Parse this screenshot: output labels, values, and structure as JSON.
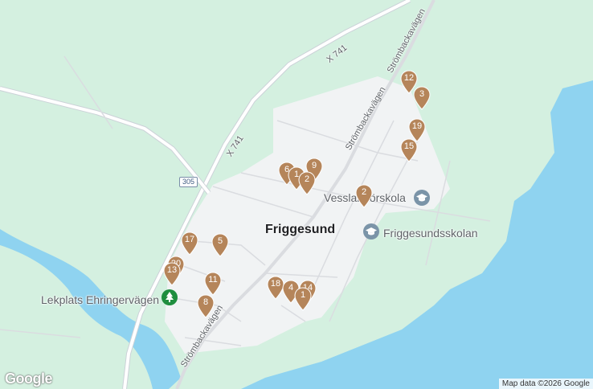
{
  "map": {
    "town_label": "Friggesund",
    "pois": [
      {
        "id": "vesslan",
        "label": "Vesslan förskola",
        "icon": "school-icon"
      },
      {
        "id": "friggesundsskolan",
        "label": "Friggesundsskolan",
        "icon": "school-icon"
      },
      {
        "id": "lekplats",
        "label": "Lekplats Ehringervägen",
        "icon": "tree-icon"
      }
    ],
    "roads": [
      {
        "id": "x741-upper",
        "label": "X 741"
      },
      {
        "id": "x741-lower",
        "label": "X 741"
      },
      {
        "id": "strom-1",
        "label": "Strömbackavägen"
      },
      {
        "id": "strom-2",
        "label": "Strömbackavägen"
      },
      {
        "id": "strom-3",
        "label": "Strömbackavägen"
      }
    ],
    "route_shield": "305",
    "markers": [
      "12",
      "3",
      "19",
      "15",
      "9",
      "6",
      "1",
      "2",
      "2",
      "17",
      "5",
      "20",
      "13",
      "11",
      "8",
      "18",
      "4",
      "14",
      "1"
    ],
    "marker_color": "#b5855a",
    "water_color": "#8fd3f0",
    "land_color": "#d4f0e0",
    "urban_color": "#f1f3f4",
    "logo": "Google",
    "attribution": "Map data ©2026 Google"
  }
}
